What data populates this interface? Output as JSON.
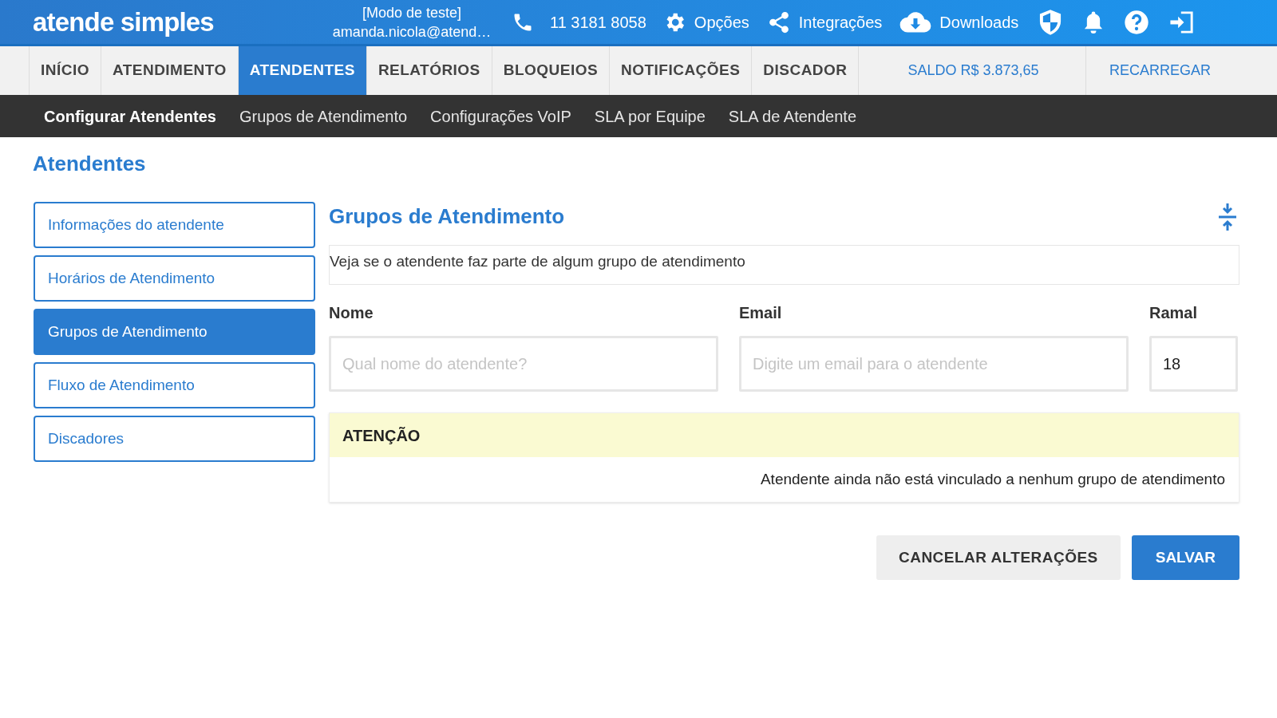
{
  "header": {
    "logo": "atende simples",
    "mode": "[Modo de teste]",
    "user": "amanda.nicola@atend…",
    "phone": "11 3181 8058",
    "links": [
      {
        "kind": "gear",
        "label": "Opções"
      },
      {
        "kind": "share",
        "label": "Integrações"
      },
      {
        "kind": "cloud",
        "label": "Downloads"
      }
    ],
    "icons": [
      {
        "kind": "shield"
      },
      {
        "kind": "bell"
      },
      {
        "kind": "help"
      },
      {
        "kind": "logout"
      }
    ]
  },
  "nav": {
    "tabs": [
      {
        "label": "INÍCIO",
        "selected": false
      },
      {
        "label": "ATENDIMENTO",
        "selected": false
      },
      {
        "label": "ATENDENTES",
        "selected": true
      },
      {
        "label": "RELATÓRIOS",
        "selected": false
      },
      {
        "label": "BLOQUEIOS",
        "selected": false
      },
      {
        "label": "NOTIFICAÇÕES",
        "selected": false
      },
      {
        "label": "DISCADOR",
        "selected": false
      }
    ],
    "balance": "SALDO R$ 3.873,65",
    "recharge": "RECARREGAR"
  },
  "subnav": [
    {
      "label": "Configurar Atendentes",
      "selected": true
    },
    {
      "label": "Grupos de Atendimento",
      "selected": false
    },
    {
      "label": "Configurações VoIP",
      "selected": false
    },
    {
      "label": "SLA por Equipe",
      "selected": false
    },
    {
      "label": "SLA de Atendente",
      "selected": false
    }
  ],
  "page_title": "Atendentes",
  "sidebar": [
    {
      "label": "Informações do atendente",
      "selected": false
    },
    {
      "label": "Horários de Atendimento",
      "selected": false
    },
    {
      "label": "Grupos de Atendimento",
      "selected": true
    },
    {
      "label": "Fluxo de Atendimento",
      "selected": false
    },
    {
      "label": "Discadores",
      "selected": false
    }
  ],
  "section": {
    "title": "Grupos de Atendimento",
    "description": "Veja se o atendente faz parte de algum grupo de atendimento",
    "fields": [
      {
        "label": "Nome",
        "placeholder": "Qual nome do atendente?"
      },
      {
        "label": "Email",
        "placeholder": "Digite um email para o atendente"
      },
      {
        "label": "Ramal",
        "value": "18"
      }
    ],
    "alert": {
      "title": "ATENÇÃO",
      "message": "Atendente ainda não está vinculado a nenhum grupo de atendimento"
    }
  },
  "buttons": [
    {
      "kind": "secondary",
      "label": "CANCELAR ALTERAÇÕES"
    },
    {
      "kind": "primary",
      "label": "SALVAR"
    }
  ]
}
